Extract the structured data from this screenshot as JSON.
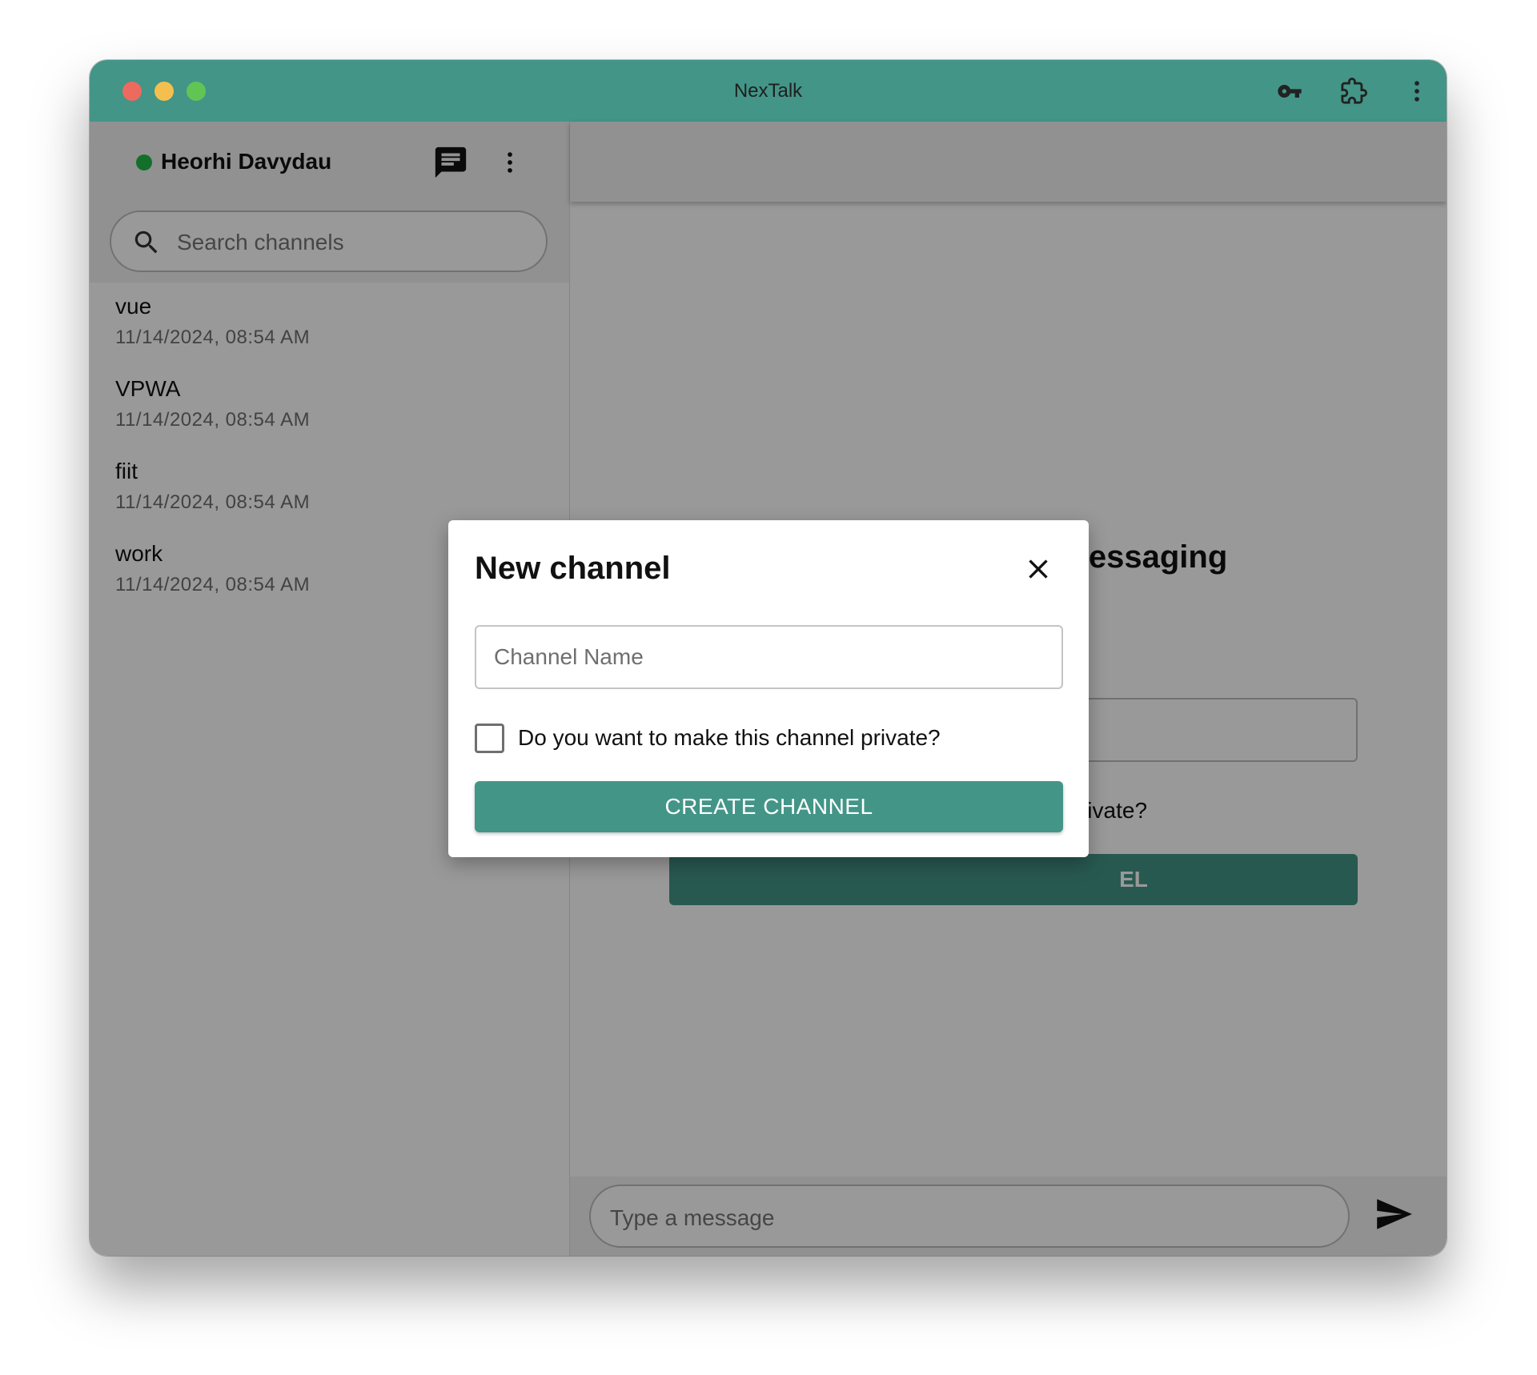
{
  "window": {
    "title": "NexTalk"
  },
  "colors": {
    "accent": "#439587",
    "status_online": "#21ba45"
  },
  "titlebar": {
    "icons": [
      "key-icon",
      "extension-icon",
      "more-vert-icon"
    ]
  },
  "sidebar": {
    "user_name": "Heorhi Davydau",
    "search_placeholder": "Search channels",
    "channels": [
      {
        "name": "vue",
        "time": "11/14/2024, 08:54 AM"
      },
      {
        "name": "VPWA",
        "time": "11/14/2024, 08:54 AM"
      },
      {
        "name": "fiit",
        "time": "11/14/2024, 08:54 AM"
      },
      {
        "name": "work",
        "time": "11/14/2024, 08:54 AM"
      }
    ]
  },
  "main": {
    "background_title": "tart messaging",
    "background_checkbox_text": "rivate?",
    "background_button_text": "EL",
    "message_placeholder": "Type a message"
  },
  "dialog": {
    "title": "New channel",
    "field_placeholder": "Channel Name",
    "checkbox_label": "Do you want to make this channel private?",
    "button_label": "CREATE CHANNEL"
  }
}
